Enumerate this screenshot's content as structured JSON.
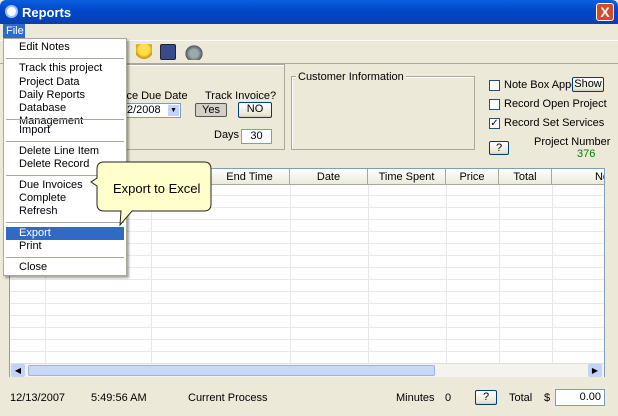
{
  "window": {
    "title": "Reports",
    "close_label": "X"
  },
  "menubar": {
    "file": "File"
  },
  "file_menu": {
    "items": [
      "Edit Notes",
      "Track this project",
      "Project Data",
      "Daily Reports",
      "Database Management",
      "Import",
      "Delete Line Item",
      "Delete Record",
      "Due Invoices",
      "Complete",
      "Refresh",
      "Export",
      "Print",
      "Close"
    ],
    "highlighted": "Export"
  },
  "callout": {
    "text": "Export to Excel"
  },
  "invoice": {
    "due_date_label": "ice Due Date",
    "due_date_value": "2/2008",
    "track_label": "Track Invoice?",
    "yes_label": "Yes",
    "no_label": "NO",
    "days_label": "Days",
    "days_value": "30"
  },
  "customer": {
    "title": "Customer Information"
  },
  "options": {
    "note_box": "Note Box Appear",
    "note_box_checked": false,
    "show_label": "Show",
    "record_open": "Record Open Project",
    "record_open_checked": false,
    "record_set": "Record Set Services",
    "record_set_checked": true,
    "help_label": "?",
    "project_number_label": "Project Number",
    "project_number_value": "376"
  },
  "grid": {
    "columns": [
      "End Time",
      "Date",
      "Time Spent",
      "Price",
      "Total",
      "No"
    ]
  },
  "status": {
    "date": "12/13/2007",
    "time": "5:49:56 AM",
    "process": "Current Process",
    "minutes_label": "Minutes",
    "minutes_value": "0",
    "help_label": "?",
    "total_label": "Total",
    "currency": "$",
    "total_value": "0.00"
  },
  "colors": {
    "titlebar": "#0047c8",
    "menu_highlight": "#316ac5",
    "callout_fill": "#ffffcc",
    "project_number": "#008000"
  }
}
